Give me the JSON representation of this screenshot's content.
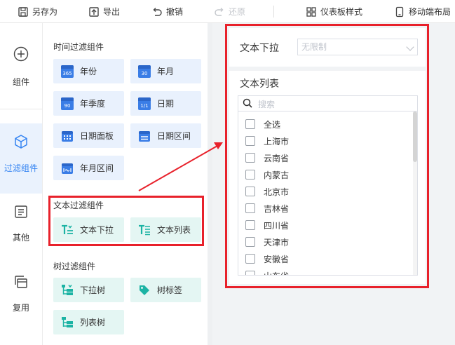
{
  "toolbar": {
    "save_as": "另存为",
    "export": "导出",
    "undo": "撤销",
    "redo": "还原",
    "dashboard_style": "仪表板样式",
    "mobile_layout": "移动端布局"
  },
  "leftnav": {
    "items": [
      {
        "label": "组件",
        "icon": "plus-circle-icon"
      },
      {
        "label": "过滤组件",
        "icon": "cube-icon"
      },
      {
        "label": "其他",
        "icon": "document-icon"
      },
      {
        "label": "复用",
        "icon": "layers-icon"
      }
    ]
  },
  "panel": {
    "time_section": {
      "title": "时间过滤组件",
      "items": [
        {
          "label": "年份",
          "icon_text": "365"
        },
        {
          "label": "年月",
          "icon_text": "30"
        },
        {
          "label": "年季度",
          "icon_text": "90"
        },
        {
          "label": "日期",
          "icon_text": "1/1"
        },
        {
          "label": "日期面板",
          "icon_text": ""
        },
        {
          "label": "日期区间",
          "icon_text": ""
        },
        {
          "label": "年月区间",
          "icon_text": ""
        }
      ]
    },
    "text_section": {
      "title": "文本过滤组件",
      "items": [
        {
          "label": "文本下拉"
        },
        {
          "label": "文本列表"
        }
      ]
    },
    "tree_section": {
      "title": "树过滤组件",
      "items": [
        {
          "label": "下拉树"
        },
        {
          "label": "树标签"
        },
        {
          "label": "列表树"
        }
      ]
    }
  },
  "preview": {
    "dropdown_widget": {
      "title": "文本下拉",
      "select_value": "无限制"
    },
    "list_widget": {
      "title": "文本列表",
      "search_placeholder": "搜索",
      "items": [
        "全选",
        "上海市",
        "云南省",
        "内蒙古",
        "北京市",
        "吉林省",
        "四川省",
        "天津市",
        "安徽省",
        "山东省"
      ]
    }
  },
  "colors": {
    "accent": "#3685f2",
    "annotation_red": "#e8212b",
    "card_blue": "#e9f1fd",
    "card_teal": "#e4f6f3"
  }
}
